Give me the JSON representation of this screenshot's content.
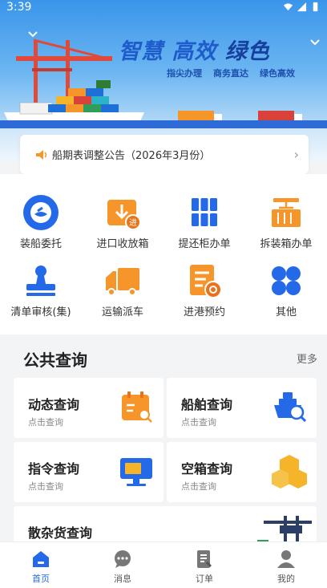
{
  "status": {
    "time": "3:39"
  },
  "banner": {
    "slogan_1": "智慧",
    "slogan_2": "高效",
    "slogan_3": "绿色",
    "sub_1": "指尖办理",
    "sub_2": "商务直达",
    "sub_3": "绿色高效"
  },
  "notice": {
    "text": "船期表调整公告（2026年3月份）",
    "chevron": "›"
  },
  "quick": [
    {
      "label": "装船委托",
      "icon": "ship-entrust-icon"
    },
    {
      "label": "进口收放箱",
      "icon": "import-box-icon"
    },
    {
      "label": "提还柜办单",
      "icon": "container-return-icon"
    },
    {
      "label": "拆装箱办单",
      "icon": "crane-box-icon"
    },
    {
      "label": "清单审核(集)",
      "icon": "stamp-icon"
    },
    {
      "label": "运输派车",
      "icon": "truck-icon"
    },
    {
      "label": "进港预约",
      "icon": "port-booking-icon"
    },
    {
      "label": "其他",
      "icon": "grid-more-icon"
    }
  ],
  "public_query": {
    "title": "公共查询",
    "more": "更多",
    "cards": [
      {
        "title": "动态查询",
        "sub": "点击查询",
        "icon": "calendar-search-icon"
      },
      {
        "title": "船舶查询",
        "sub": "点击查询",
        "icon": "ship-search-icon"
      },
      {
        "title": "指令查询",
        "sub": "点击查询",
        "icon": "monitor-icon"
      },
      {
        "title": "空箱查询",
        "sub": "点击查询",
        "icon": "boxes-icon"
      },
      {
        "title": "散杂货查询",
        "sub": "",
        "icon": "port-crane-icon"
      }
    ]
  },
  "tabs": [
    {
      "label": "首页",
      "icon": "home-icon",
      "active": true
    },
    {
      "label": "消息",
      "icon": "message-icon",
      "active": false
    },
    {
      "label": "订单",
      "icon": "order-icon",
      "active": false
    },
    {
      "label": "我的",
      "icon": "user-icon",
      "active": false
    }
  ],
  "colors": {
    "primary": "#2469e8",
    "orange": "#f5952a",
    "hero_top": "#3a95ea"
  }
}
